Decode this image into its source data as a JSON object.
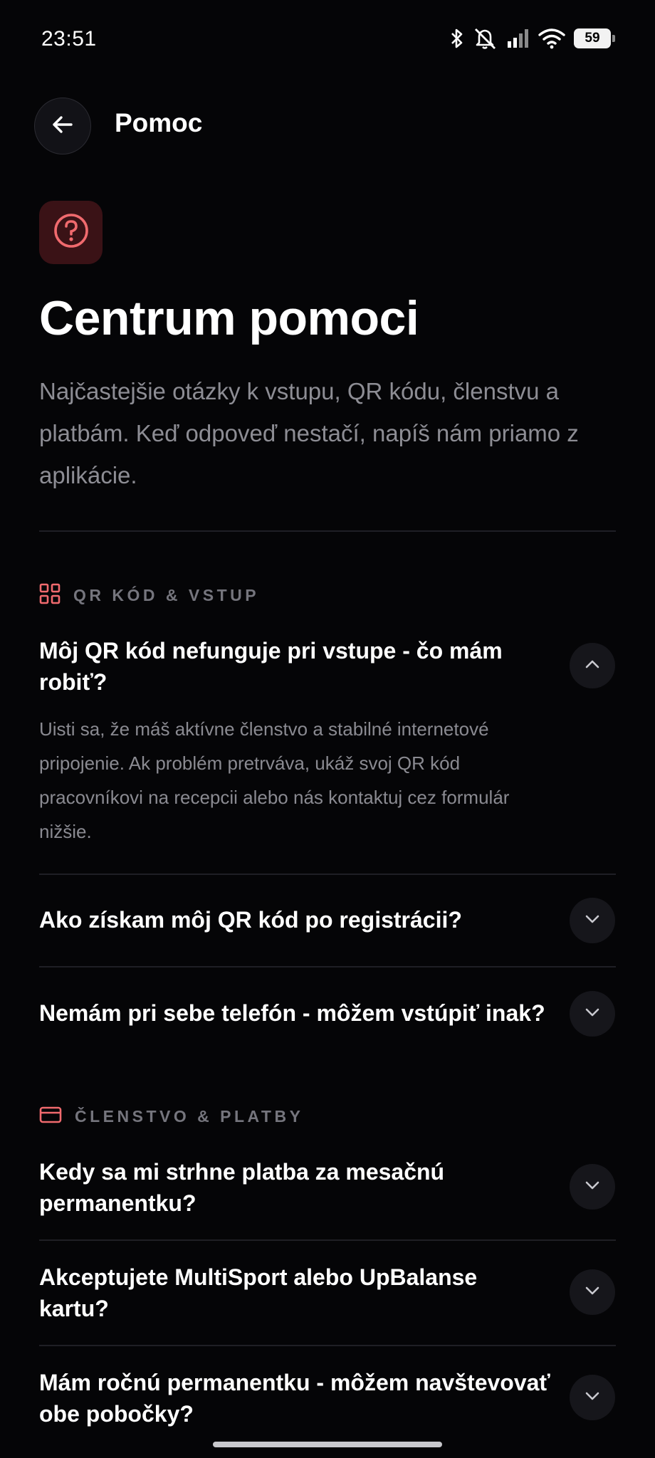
{
  "status_bar": {
    "time": "23:51",
    "battery": "59",
    "icons": [
      "bluetooth-icon",
      "mute-icon",
      "signal-icon",
      "wifi-icon",
      "battery-icon"
    ]
  },
  "app_bar": {
    "title": "Pomoc",
    "back_icon": "arrow-left-icon"
  },
  "hero": {
    "icon": "question-circle-icon",
    "title": "Centrum pomoci",
    "subtitle": "Najčastejšie otázky k vstupu, QR kódu, členstvu a platbám. Keď odpoveď nestačí, napíš nám priamo z aplikácie."
  },
  "sections": [
    {
      "icon": "grid-icon",
      "label": "QR KÓD & VSTUP",
      "items": [
        {
          "question": "Môj QR kód nefunguje pri vstupe - čo mám robiť?",
          "expanded": true,
          "answer": "Uisti sa, že máš aktívne členstvo a stabilné internetové pripojenie. Ak problém pretrváva, ukáž svoj QR kód pracovníkovi na recepcii alebo nás kontaktuj cez formulár nižšie."
        },
        {
          "question": "Ako získam môj QR kód po registrácii?",
          "expanded": false
        },
        {
          "question": "Nemám pri sebe telefón - môžem vstúpiť inak?",
          "expanded": false
        }
      ]
    },
    {
      "icon": "credit-card-icon",
      "label": "ČLENSTVO & PLATBY",
      "items": [
        {
          "question": "Kedy sa mi strhne platba za mesačnú permanentku?",
          "expanded": false
        },
        {
          "question": "Akceptujete MultiSport alebo UpBalanse kartu?",
          "expanded": false
        },
        {
          "question": "Mám ročnú permanentku - môžem navštevovať obe pobočky?",
          "expanded": false
        }
      ]
    }
  ],
  "colors": {
    "background": "#050507",
    "accent": "#f06a6e",
    "accent_bg": "#3a1216",
    "muted_text": "#8d8d94",
    "divider": "#1f1f25"
  }
}
